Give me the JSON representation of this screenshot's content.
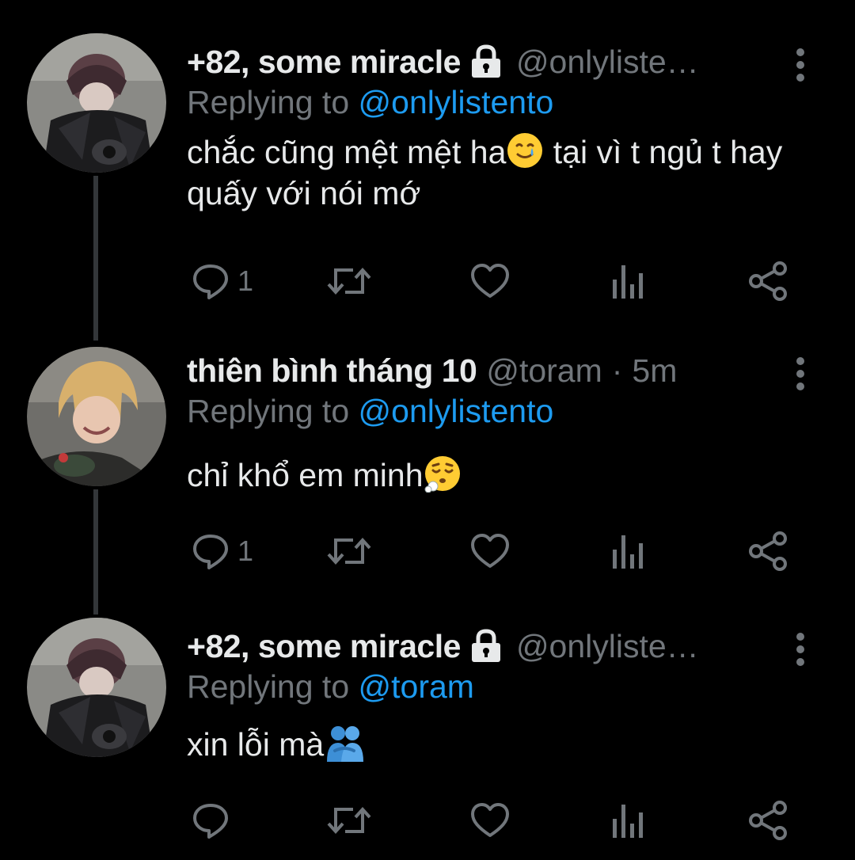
{
  "colors": {
    "background": "#000000",
    "text": "#e7e9ea",
    "secondary": "#71767b",
    "accent": "#1d9bf0",
    "thread_line": "#333639"
  },
  "tweets": [
    {
      "display_name": "+82, some miracle",
      "protected": true,
      "handle": "@onlyliste…",
      "reply_prefix": "Replying to ",
      "reply_to": "@onlylistento",
      "text_parts": [
        "chắc cũng mệt mệt ha",
        " tại vì t ngủ t hay quấy với nói mớ"
      ],
      "emoji": "smiling-face-with-tear",
      "reply_count": "1"
    },
    {
      "display_name": "thiên bình tháng 10",
      "protected": false,
      "handle": "@toram",
      "separator": "·",
      "time": "5m",
      "reply_prefix": "Replying to ",
      "reply_to": "@onlylistento",
      "text_parts": [
        "chỉ khổ em minh"
      ],
      "emoji": "face-exhaling",
      "reply_count": "1"
    },
    {
      "display_name": "+82, some miracle",
      "protected": true,
      "handle": "@onlyliste…",
      "reply_prefix": "Replying to ",
      "reply_to": "@toram",
      "text_parts": [
        "xin lỗi mà"
      ],
      "emoji": "people-hugging",
      "reply_count": ""
    }
  ],
  "icons": {
    "reply": "reply-icon",
    "retweet": "retweet-icon",
    "like": "heart-icon",
    "views": "bar-chart-icon",
    "share": "share-icon",
    "more": "more-vertical-icon",
    "lock": "lock-icon"
  }
}
